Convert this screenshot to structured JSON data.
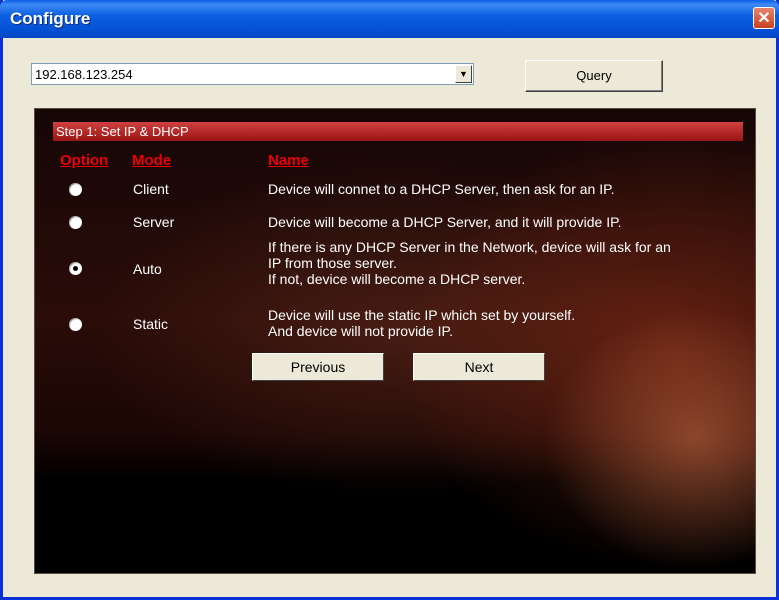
{
  "window": {
    "title": "Configure",
    "close_glyph": "✕"
  },
  "ip_select": {
    "value": "192.168.123.254",
    "arrow": "▼"
  },
  "query_label": "Query",
  "step": {
    "title": "Step 1: Set IP & DHCP",
    "headers": {
      "option": "Option",
      "mode": "Mode",
      "name": "Name"
    },
    "options": [
      {
        "mode": "Client",
        "checked": false,
        "desc": [
          "Device will connet to a DHCP Server, then ask for an IP."
        ]
      },
      {
        "mode": "Server",
        "checked": false,
        "desc": [
          "Device will become a DHCP Server, and it will provide IP."
        ]
      },
      {
        "mode": "Auto",
        "checked": true,
        "desc": [
          "If there is any DHCP Server in the Network, device will ask for an",
          "IP from those server.",
          "If not, device will become a DHCP server."
        ]
      },
      {
        "mode": "Static",
        "checked": false,
        "desc": [
          "Device will use the static IP which set by yourself.",
          "And device will not provide IP."
        ]
      }
    ]
  },
  "nav": {
    "previous": "Previous",
    "next": "Next"
  },
  "colors": {
    "title_bar": "#0554d8",
    "header_bar": "#b02020",
    "column_heading": "#ee0000",
    "panel_bg": "#1a0604"
  }
}
